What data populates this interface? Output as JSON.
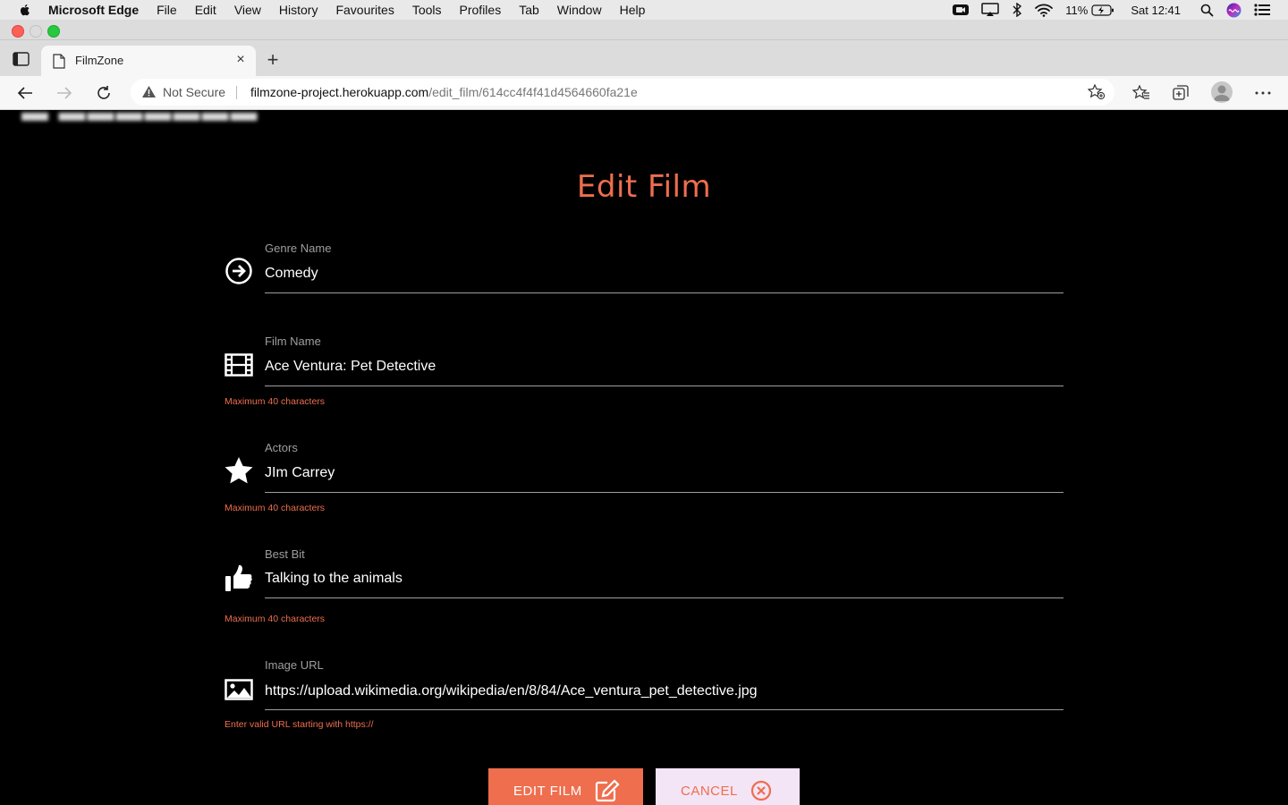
{
  "menubar": {
    "app_name": "Microsoft Edge",
    "items": [
      "File",
      "Edit",
      "View",
      "History",
      "Favourites",
      "Tools",
      "Profiles",
      "Tab",
      "Window",
      "Help"
    ],
    "battery": "11%",
    "clock": "Sat 12:41"
  },
  "browser": {
    "tab_title": "FilmZone",
    "security_label": "Not Secure",
    "url_host": "filmzone-project.herokuapp.com",
    "url_path": "/edit_film/614cc4f4f41d4564660fa21e"
  },
  "page": {
    "heading": "Edit Film",
    "fields": {
      "genre": {
        "label": "Genre Name",
        "value": "Comedy"
      },
      "film_name": {
        "label": "Film Name",
        "value": "Ace Ventura: Pet Detective",
        "helper": "Maximum 40 characters"
      },
      "actors": {
        "label": "Actors",
        "value": "JIm Carrey",
        "helper": "Maximum 40 characters"
      },
      "best_bit": {
        "label": "Best Bit",
        "value": "Talking to the animals",
        "helper": "Maximum 40 characters"
      },
      "image_url": {
        "label": "Image URL",
        "value": "https://upload.wikimedia.org/wikipedia/en/8/84/Ace_ventura_pet_detective.jpg",
        "helper": "Enter valid URL starting with https://"
      }
    },
    "buttons": {
      "edit": "EDIT FILM",
      "cancel": "CANCEL"
    }
  },
  "colors": {
    "accent": "#ee6e4e",
    "page_bg": "#000000",
    "cancel_bg": "#f3e5f5"
  }
}
